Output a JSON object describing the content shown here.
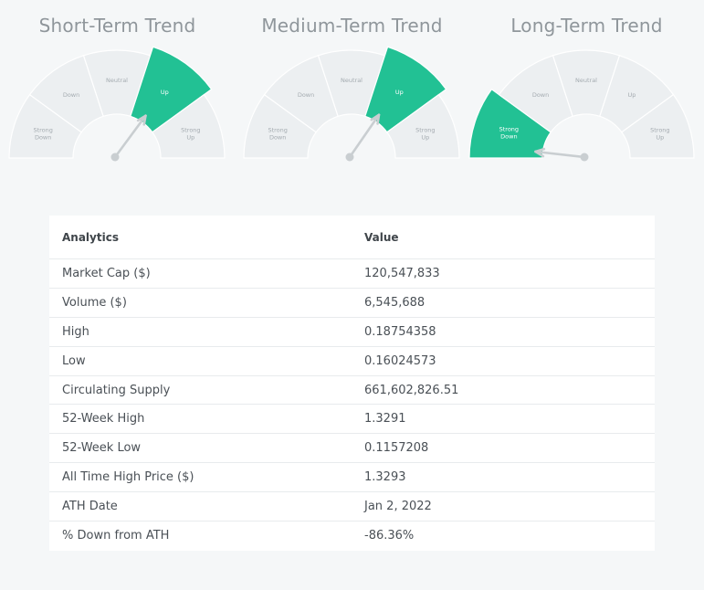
{
  "gauges": [
    {
      "title": "Short-Term Trend",
      "segments": [
        "Strong Down",
        "Down",
        "Neutral",
        "Up",
        "Strong Up"
      ],
      "active_index": 3,
      "needle_level": 0.69
    },
    {
      "title": "Medium-Term Trend",
      "segments": [
        "Strong Down",
        "Down",
        "Neutral",
        "Up",
        "Strong Up"
      ],
      "active_index": 3,
      "needle_level": 0.68
    },
    {
      "title": "Long-Term Trend",
      "segments": [
        "Strong Down",
        "Down",
        "Neutral",
        "Up",
        "Strong Up"
      ],
      "active_index": 0,
      "needle_level": 0.04
    }
  ],
  "colors": {
    "active": "#22c194",
    "inactive": "#eceff1",
    "needle": "#c9ced1"
  },
  "table": {
    "headers": [
      "Analytics",
      "Value"
    ],
    "rows": [
      [
        "Market Cap ($)",
        "120,547,833"
      ],
      [
        "Volume ($)",
        "6,545,688"
      ],
      [
        "High",
        "0.18754358"
      ],
      [
        "Low",
        "0.16024573"
      ],
      [
        "Circulating Supply",
        "661,602,826.51"
      ],
      [
        "52-Week High",
        "1.3291"
      ],
      [
        "52-Week Low",
        "0.1157208"
      ],
      [
        "All Time High Price ($)",
        "1.3293"
      ],
      [
        "ATH Date",
        "Jan 2, 2022"
      ],
      [
        "% Down from ATH",
        "-86.36%"
      ]
    ]
  }
}
